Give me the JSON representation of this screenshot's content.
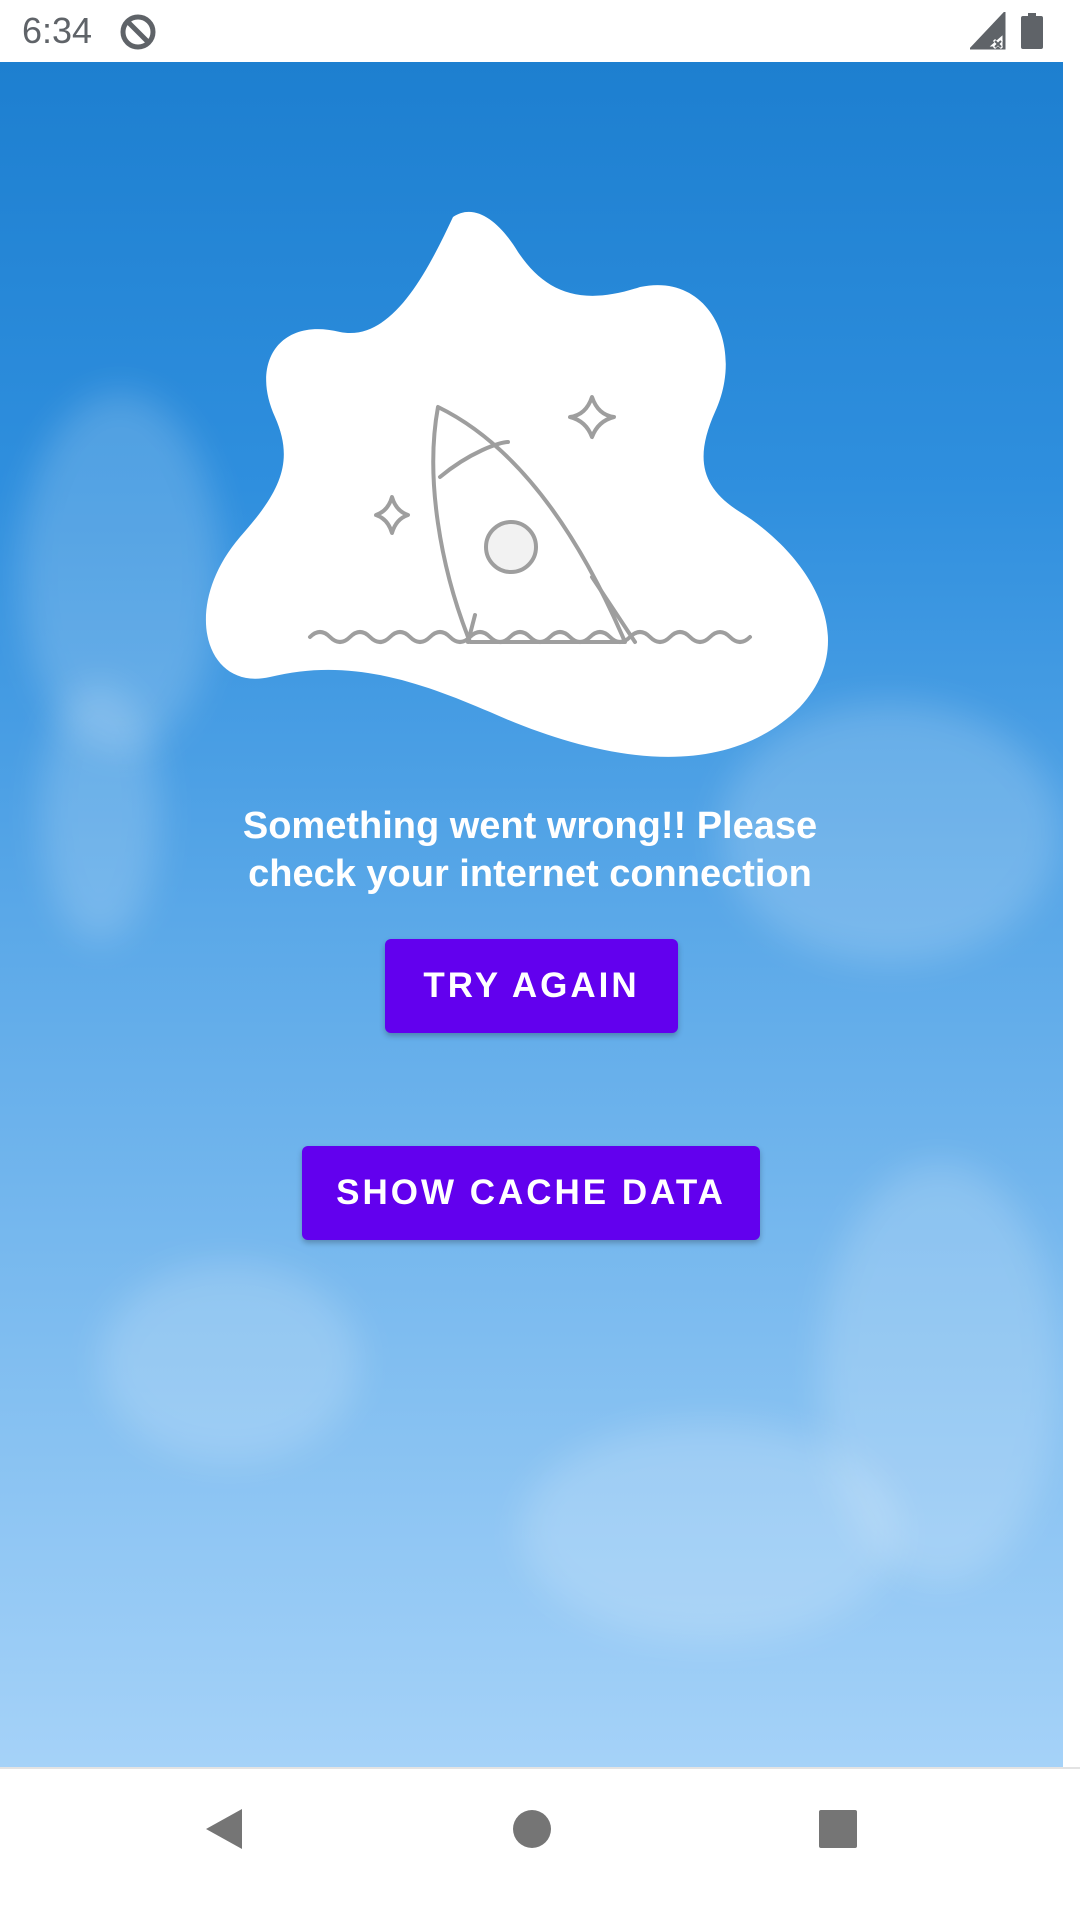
{
  "status_bar": {
    "time": "6:34",
    "icons": [
      "data-saver-icon",
      "signal-no-data-icon",
      "battery-icon"
    ]
  },
  "error_screen": {
    "illustration": "rocket-illustration",
    "message_line1": "Something went wrong!! Please",
    "message_line2": "check your internet connection",
    "try_again_label": "TRY AGAIN",
    "show_cache_label": "SHOW CACHE DATA"
  },
  "navigation": {
    "buttons": [
      "back-icon",
      "home-icon",
      "recents-icon"
    ]
  },
  "colors": {
    "button": "#6200ee",
    "sky_top": "#1d7fd0",
    "sky_bottom": "#a5d2f8",
    "text": "#ffffff"
  }
}
